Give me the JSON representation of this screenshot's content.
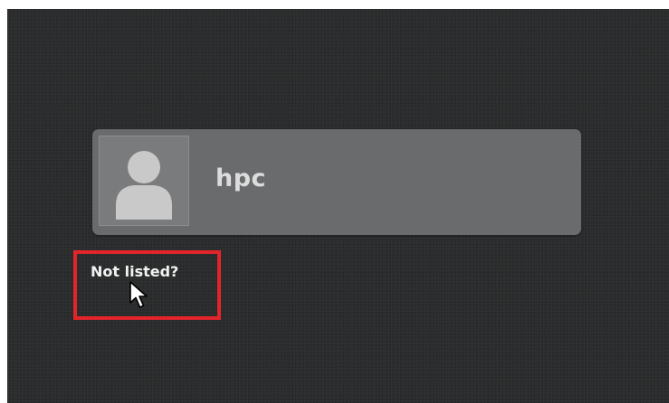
{
  "user_list": {
    "users": [
      {
        "name": "hpc",
        "avatar_icon": "user-avatar-icon"
      }
    ]
  },
  "not_listed_link": {
    "label": "Not listed?"
  },
  "annotation": {
    "highlight_color": "#e3242b"
  },
  "pointer": {
    "icon": "mouse-pointer-icon"
  }
}
